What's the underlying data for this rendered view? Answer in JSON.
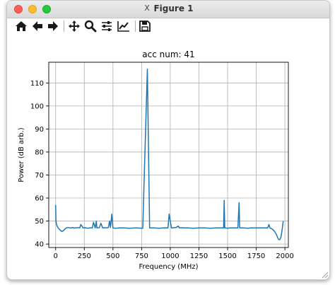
{
  "window": {
    "title": "Figure 1",
    "x_icon": "X"
  },
  "toolbar": {
    "buttons": [
      {
        "name": "home-button",
        "icon": "home-icon"
      },
      {
        "name": "back-button",
        "icon": "arrow-left-icon"
      },
      {
        "name": "forward-button",
        "icon": "arrow-right-icon"
      },
      {
        "name": "pan-button",
        "icon": "move-icon"
      },
      {
        "name": "zoom-button",
        "icon": "magnifier-icon"
      },
      {
        "name": "subplots-button",
        "icon": "sliders-icon"
      },
      {
        "name": "edit-axis-button",
        "icon": "line-chart-icon"
      },
      {
        "name": "save-button",
        "icon": "floppy-disk-icon"
      }
    ]
  },
  "chart_data": {
    "type": "line",
    "title": "acc num: 41",
    "xlabel": "Frequency (MHz)",
    "ylabel": "Power (dB arb.)",
    "xlim": [
      -60,
      2030
    ],
    "ylim": [
      38.5,
      119
    ],
    "xticks": [
      0,
      250,
      500,
      750,
      1000,
      1250,
      1500,
      1750,
      2000
    ],
    "yticks": [
      40,
      50,
      60,
      70,
      80,
      90,
      100,
      110
    ],
    "grid": true,
    "line_color": "#1f77b4",
    "series": [
      {
        "x": [
          0,
          3,
          8,
          15,
          25,
          35,
          45,
          55,
          65,
          72,
          78,
          85,
          95,
          110,
          130,
          150,
          160,
          170,
          180,
          195,
          210,
          220,
          240,
          260,
          280,
          300,
          320,
          330,
          345,
          355,
          360,
          380,
          395,
          410,
          430,
          450,
          460,
          470,
          478,
          490,
          500,
          520,
          560,
          600,
          640,
          700,
          760,
          800,
          820,
          860,
          900,
          940,
          980,
          990,
          1010,
          1050,
          1070,
          1080,
          1100,
          1120,
          1150,
          1200,
          1250,
          1300,
          1350,
          1400,
          1440,
          1465,
          1470,
          1475,
          1480,
          1500,
          1520,
          1560,
          1590,
          1600,
          1605,
          1610,
          1640,
          1680,
          1700,
          1750,
          1800,
          1850,
          1860,
          1870,
          1890,
          1910,
          1925,
          1935,
          1945,
          1955,
          1965,
          1975,
          1985
        ],
        "y": [
          57,
          50,
          48.5,
          47.5,
          46.8,
          46.3,
          45.8,
          45.5,
          45.7,
          46,
          46.4,
          46.8,
          47,
          47.2,
          47,
          47.2,
          46.9,
          47.1,
          47,
          47.2,
          47,
          48.5,
          47,
          47.1,
          46.9,
          47,
          47,
          49.5,
          47,
          50,
          47,
          47.1,
          49,
          47,
          47.1,
          47,
          47.2,
          50,
          47.2,
          53,
          47,
          46.9,
          47,
          47,
          46.9,
          47,
          46.9,
          116,
          47,
          47,
          46.9,
          47,
          47,
          53,
          47,
          47.2,
          47.8,
          47,
          47.1,
          47,
          47,
          46.9,
          47,
          47,
          46.9,
          47,
          47,
          47,
          59,
          47,
          47,
          46.9,
          47,
          47,
          47,
          58,
          47,
          47,
          47,
          46.9,
          47,
          47,
          47,
          47,
          48.5,
          47,
          46.5,
          45.5,
          44.2,
          43,
          42,
          41.9,
          43,
          46,
          50
        ]
      }
    ]
  }
}
